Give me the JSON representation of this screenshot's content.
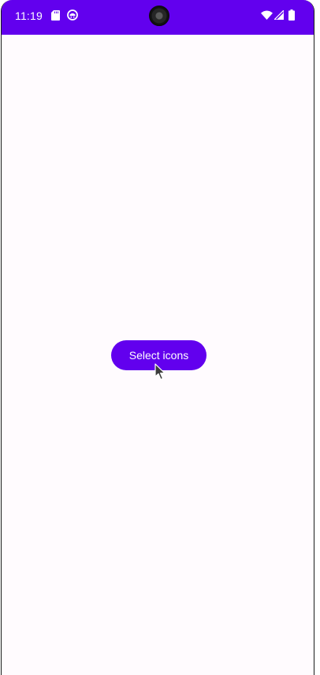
{
  "status_bar": {
    "time": "11:19",
    "background_color": "#6200ee",
    "left_icons": [
      "sd-card-icon",
      "app-notification-icon"
    ],
    "right_icons": [
      "wifi-icon",
      "cell-signal-icon",
      "battery-icon"
    ]
  },
  "main": {
    "select_button_label": "Select icons",
    "accent_color": "#6200ee",
    "background_color": "#fffbfe"
  }
}
